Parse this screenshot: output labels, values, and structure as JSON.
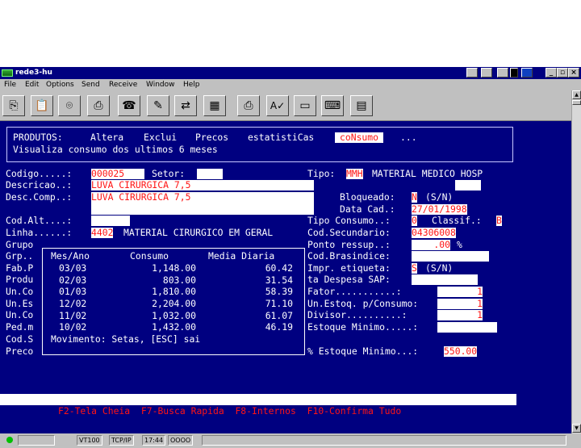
{
  "window": {
    "title": "rede3-hu"
  },
  "menu": [
    "File",
    "Edit",
    "Options",
    "Send",
    "Receive",
    "Window",
    "Help"
  ],
  "toolbar_icons": [
    "copy-icon",
    "paste-icon",
    "camera-icon",
    "print-icon",
    "phone-icon",
    "pen-icon",
    "transfer-icon",
    "grid-icon",
    "printer-icon",
    "spellcheck-icon",
    "monitor-icon",
    "keyboard-icon",
    "notepad-icon"
  ],
  "header": {
    "menu_prefix": "PRODUTOS:",
    "altera": "Altera",
    "exclui": "Exclui",
    "precos": "Precos",
    "estatisticas": "estatistiCas",
    "consumo": "coNsumo",
    "more": "...",
    "subtitle": "Visualiza consumo dos ultimos 6 meses"
  },
  "form": {
    "codigo_label": "Codigo.....:",
    "codigo": "000025",
    "setor_label": "Setor:",
    "descricao_label": "Descricao..:",
    "descricao": "LUVA CIRURGICA 7,5",
    "desccomp_label": "Desc.Comp..:",
    "desccomp": "LUVA CIRURGICA 7,5",
    "codalt_label": "Cod.Alt....:",
    "linha_label": "Linha......:",
    "linha_code": "4402",
    "linha_desc": "MATERIAL CIRURGICO EM GERAL",
    "left_labels": [
      "Grupo",
      "Grp..",
      "Fab.P",
      "Produ",
      "Un.Co",
      "Un.Es",
      "Un.Co",
      "Ped.m",
      "Cod.S",
      "Preco"
    ],
    "tipo_label": "Tipo:",
    "tipo_code": "MMH",
    "tipo_desc": "MATERIAL MEDICO HOSP",
    "bloqueado_label": "Bloqueado:",
    "bloqueado": "N",
    "bloqueado_hint": "(S/N)",
    "datacad_label": "Data Cad.:",
    "datacad": "27/01/1998",
    "tipoconsumo_label": "Tipo Consumo..:",
    "tipoconsumo": "0",
    "classif_label": "Classif.:",
    "classif": "B",
    "codsec_label": "Cod.Secundario:",
    "codsec": "04306008",
    "pontoressup_label": "Ponto ressup..:",
    "pontoressup": ".00",
    "pontoressup_unit": "%",
    "codbras_label": "Cod.Brasindice:",
    "impr_label": "Impr. etiqueta:",
    "impr": "S",
    "impr_hint": "(S/N)",
    "despesa_label": "ta Despesa SAP:",
    "fator_label": "Fator...........:",
    "fator": "1",
    "estoq_label": "Un.Estoq. p/Consumo:",
    "estoq": "1",
    "divisor_label": "Divisor..........:",
    "divisor": "1",
    "estmin_label": "Estoque Minimo.....:",
    "pctmin_label": "% Estoque Minimo...:",
    "pctmin": "550.00"
  },
  "consumo_table": {
    "headers": [
      "Mes/Ano",
      "Consumo",
      "Media Diaria"
    ],
    "rows": [
      {
        "mes": "03/03",
        "consumo": "1,148.00",
        "media": "60.42"
      },
      {
        "mes": "02/03",
        "consumo": "803.00",
        "media": "31.54"
      },
      {
        "mes": "01/03",
        "consumo": "1,810.00",
        "media": "58.39"
      },
      {
        "mes": "12/02",
        "consumo": "2,204.00",
        "media": "71.10"
      },
      {
        "mes": "11/02",
        "consumo": "1,032.00",
        "media": "61.07"
      },
      {
        "mes": "10/02",
        "consumo": "1,432.00",
        "media": "46.19"
      }
    ],
    "footer": "Movimento: Setas, [ESC] sai"
  },
  "function_keys": "F2-Tela Cheia  F7-Busca Rapida  F8-Internos  F10-Confirma Tudo",
  "status": {
    "terminal": "VT100",
    "protocol": "TCP/IP",
    "time": "17:44",
    "indicator": "OOOO"
  }
}
